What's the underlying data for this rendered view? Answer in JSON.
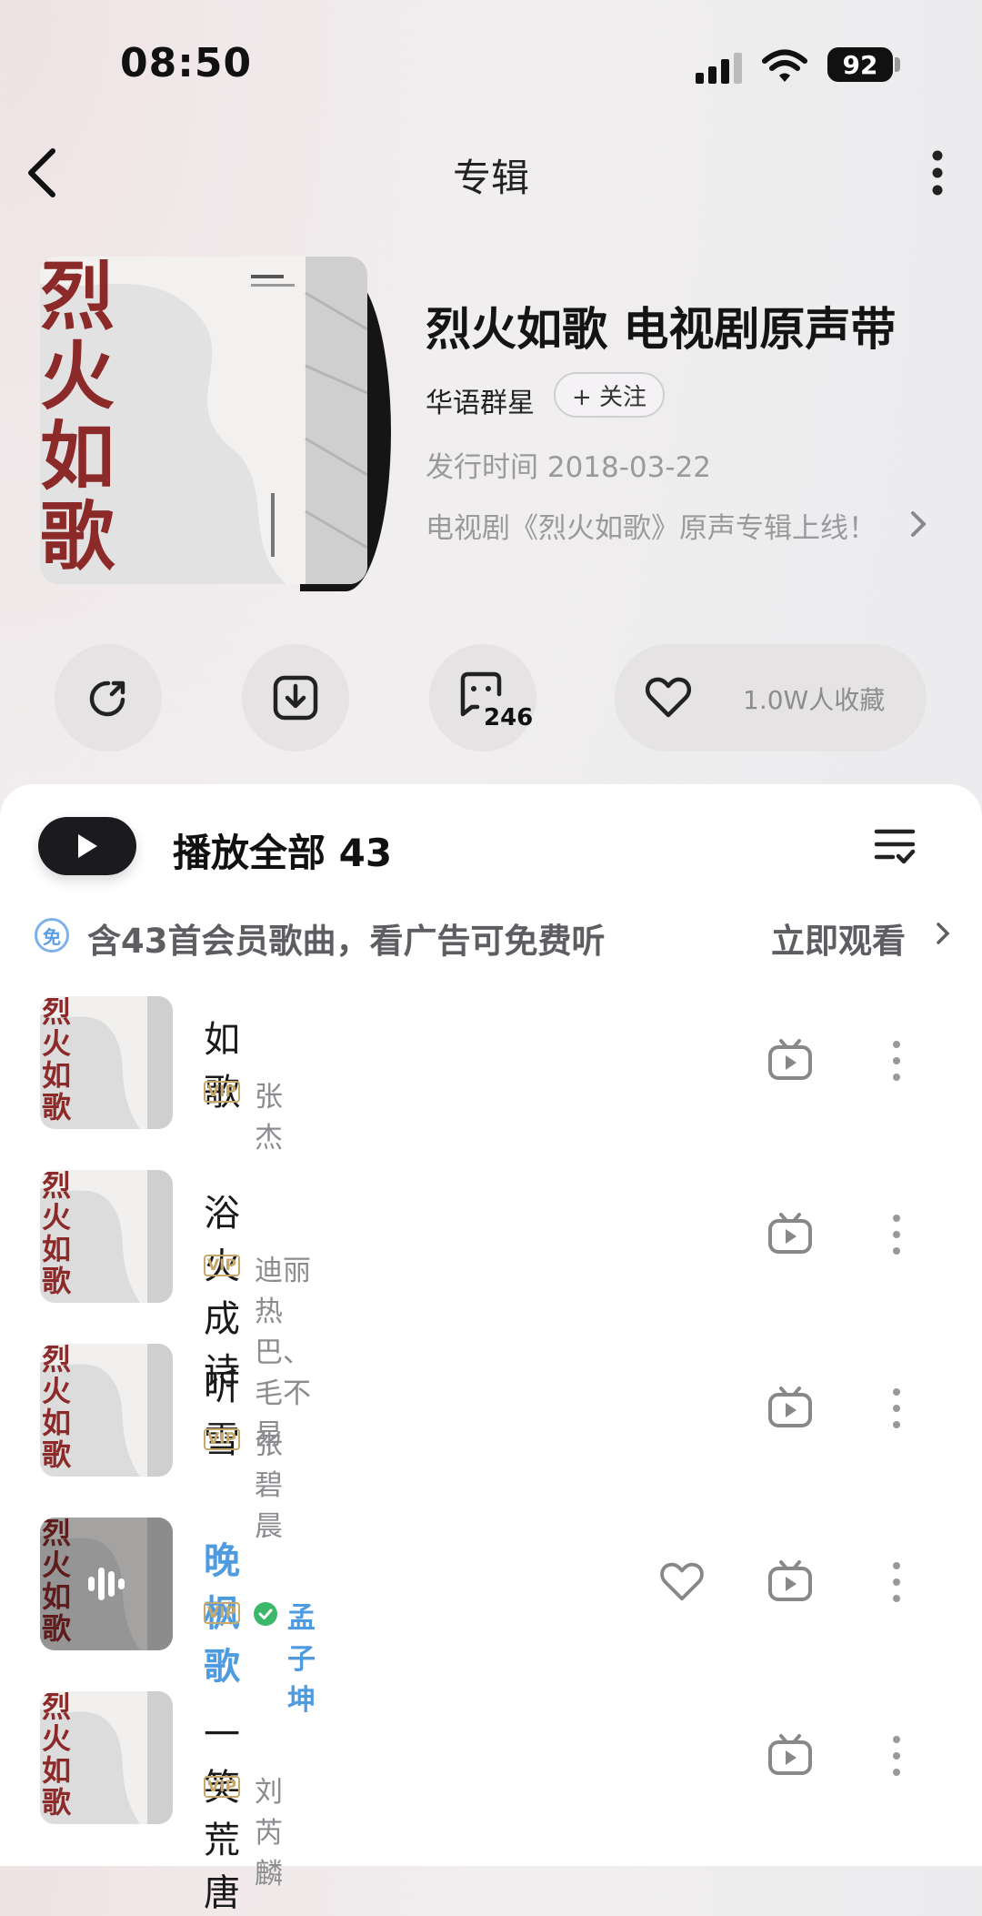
{
  "status_bar": {
    "time": "08:50",
    "battery": "92"
  },
  "nav": {
    "title": "专辑"
  },
  "album": {
    "title": "烈火如歌 电视剧原声带",
    "artist": "华语群星",
    "follow_label": "+ 关注",
    "release": "发行时间   2018-03-22",
    "description": "电视剧《烈火如歌》原声专辑上线！",
    "cover_text": "烈火如歌"
  },
  "actions": {
    "comment_count": "246",
    "favorites": "1.0W人收藏"
  },
  "playlist": {
    "play_all": "播放全部 43"
  },
  "vip_banner": {
    "icon_text": "免",
    "text": "含43首会员歌曲，看广告可免费听",
    "action": "立即观看"
  },
  "songs": [
    {
      "title": "如歌",
      "tag": "VIP",
      "artist": "张杰"
    },
    {
      "title": "浴火成诗",
      "tag": "VIP",
      "artist": "迪丽热巴、毛不易"
    },
    {
      "title": "听雪",
      "tag": "VIP",
      "artist": "张碧晨"
    },
    {
      "title": "晚枫歌",
      "tag": "VIP",
      "artist": "孟子坤"
    },
    {
      "title": "一笑荒唐",
      "tag": "VIP",
      "artist": "刘芮麟"
    }
  ],
  "colors": {
    "accent_blue": "#4f9be0",
    "vip_gold": "#c7a76a",
    "cover_red": "#8c2a2a"
  }
}
